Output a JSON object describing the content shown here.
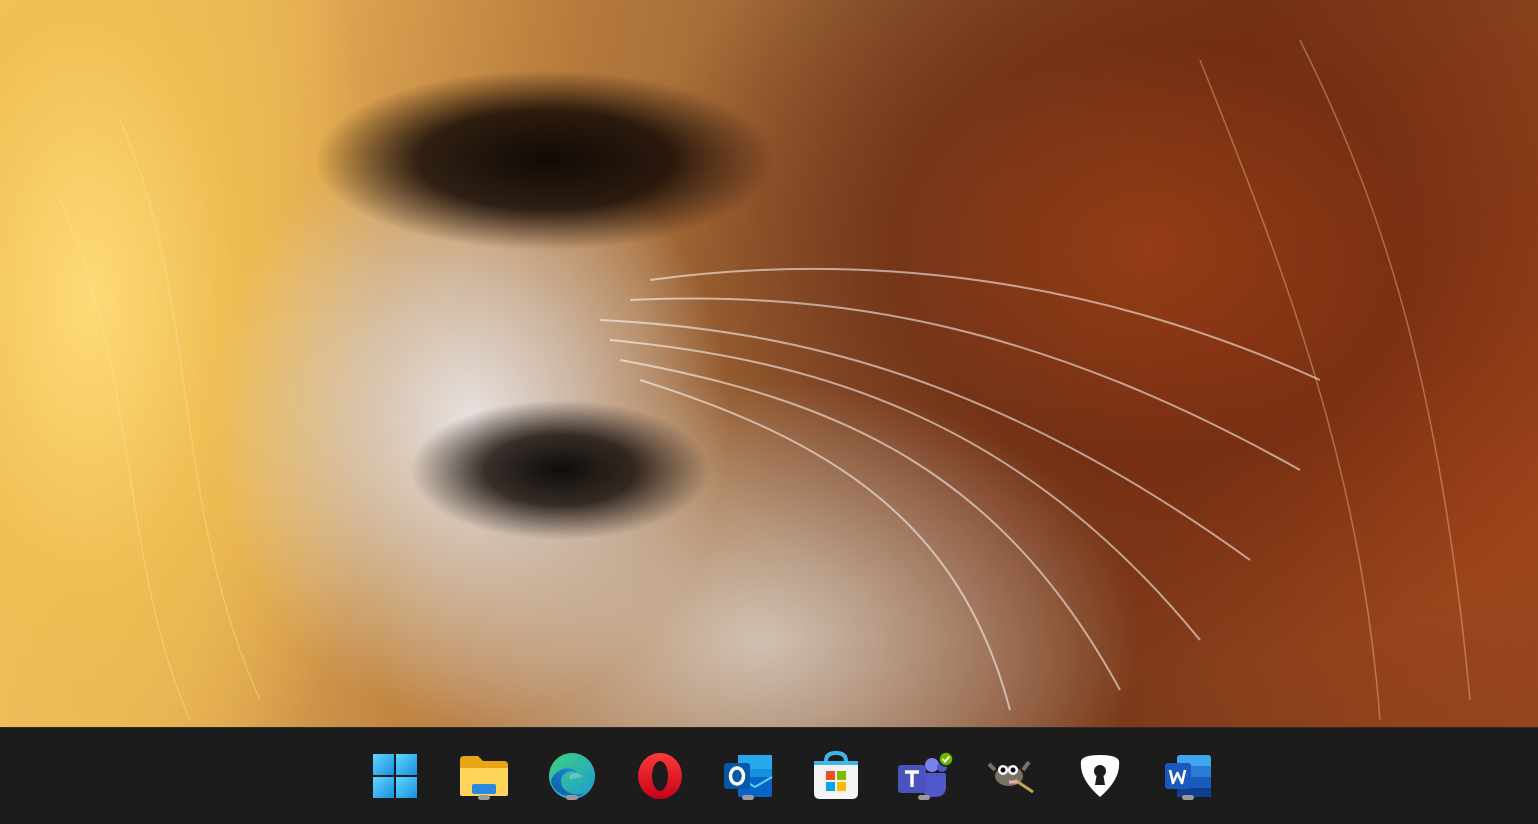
{
  "colors": {
    "taskbar_bg": "#1c1c1c",
    "running_indicator": "#9a9a9a"
  },
  "taskbar": {
    "apps": [
      {
        "name": "start",
        "icon": "windows-logo-icon",
        "running": false
      },
      {
        "name": "file-explorer",
        "icon": "folder-icon",
        "running": true
      },
      {
        "name": "edge",
        "icon": "edge-browser-icon",
        "running": true
      },
      {
        "name": "opera",
        "icon": "opera-browser-icon",
        "running": false
      },
      {
        "name": "outlook",
        "icon": "outlook-mail-icon",
        "running": true
      },
      {
        "name": "store",
        "icon": "microsoft-store-icon",
        "running": false
      },
      {
        "name": "teams",
        "icon": "teams-icon",
        "running": true
      },
      {
        "name": "gimp",
        "icon": "gimp-icon",
        "running": false
      },
      {
        "name": "password-manager",
        "icon": "keyhole-shield-icon",
        "running": false
      },
      {
        "name": "word",
        "icon": "word-document-icon",
        "running": true
      }
    ]
  }
}
